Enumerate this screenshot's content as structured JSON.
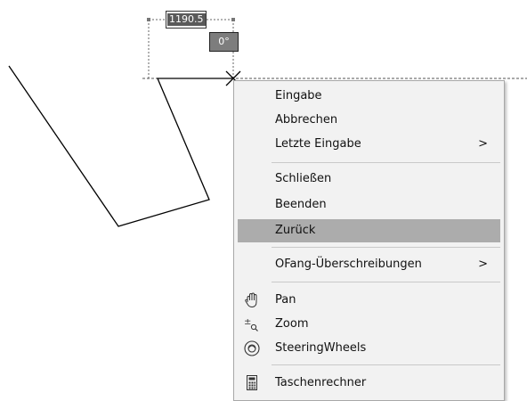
{
  "dimension_input": {
    "value": "1190.5"
  },
  "angle_tooltip": {
    "value": "0°"
  },
  "context_menu": {
    "items": [
      {
        "label": "Eingabe"
      },
      {
        "label": "Abbrechen"
      },
      {
        "label": "Letzte Eingabe",
        "submenu": ">"
      },
      {
        "label": "Schließen"
      },
      {
        "label": "Beenden"
      },
      {
        "label": "Zurück",
        "highlighted": true
      },
      {
        "label": "OFang-Überschreibungen",
        "submenu": ">"
      },
      {
        "label": "Pan",
        "icon": "hand-pan-icon"
      },
      {
        "label": "Zoom",
        "icon": "zoom-icon"
      },
      {
        "label": "SteeringWheels",
        "icon": "steering-wheels-icon"
      },
      {
        "label": "Taschenrechner",
        "icon": "calculator-icon"
      }
    ]
  },
  "colors": {
    "highlight": "#acacac",
    "menu_bg": "#f2f2f2",
    "angle_box": "#7d7d7d",
    "drawing_line": "#000000"
  }
}
